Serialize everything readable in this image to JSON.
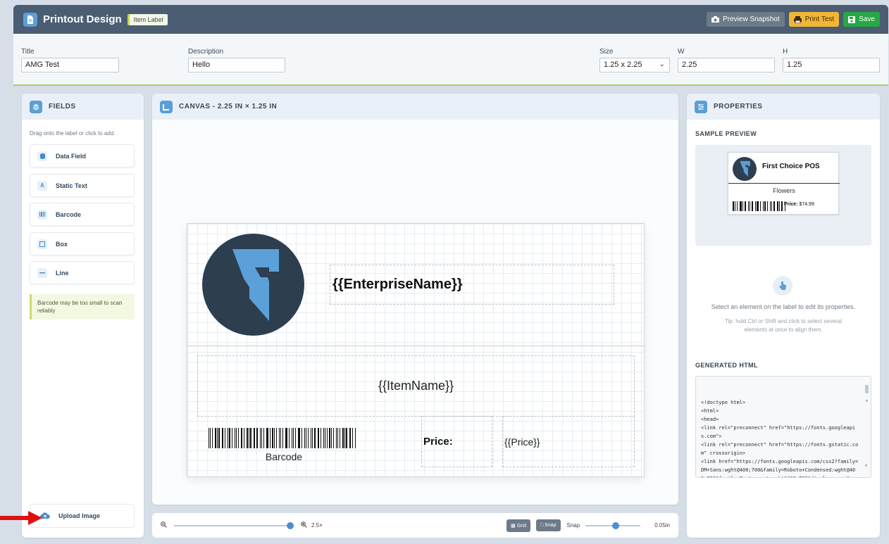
{
  "header": {
    "title": "Printout Design",
    "badge": "Item Label",
    "preview_snapshot": "Preview Snapshot",
    "print_test": "Print Test",
    "save": "Save"
  },
  "meta": {
    "title_label": "Title",
    "title_value": "AMG Test",
    "description_label": "Description",
    "description_value": "Hello",
    "size_label": "Size",
    "size_value": "1.25 x 2.25",
    "w_label": "W",
    "w_value": "2.25",
    "h_label": "H",
    "h_value": "1.25"
  },
  "fields_panel": {
    "title": "FIELDS",
    "hint": "Drag onto the label or click to add.",
    "items": [
      {
        "label": "Data Field",
        "icon": "database-icon"
      },
      {
        "label": "Static Text",
        "icon": "text-icon"
      },
      {
        "label": "Barcode",
        "icon": "barcode-icon"
      },
      {
        "label": "Box",
        "icon": "box-icon"
      },
      {
        "label": "Line",
        "icon": "line-icon"
      }
    ],
    "warning": "Barcode may be too small to scan reliably",
    "upload": "Upload Image"
  },
  "canvas": {
    "title": "CANVAS - 2.25 IN × 1.25 IN",
    "enterprise": "{{EnterpriseName}}",
    "item_name": "{{ItemName}}",
    "barcode_text": "Barcode",
    "price_label": "Price:",
    "price_value": "{{Price}}"
  },
  "zoombar": {
    "zoom": "2.5×",
    "grid": "Grid",
    "snap_btn": "Snap",
    "snap_label": "Snap",
    "snap_value": "0.05in",
    "zoom_level": 0.98,
    "snap_level": 0.55
  },
  "properties": {
    "title": "PROPERTIES",
    "sample_title": "SAMPLE PREVIEW",
    "sample_name": "First Choice POS",
    "sample_item": "Flowers",
    "sample_price_label": "Price:",
    "sample_price": "$74.99",
    "select_text": "Select an element on the label to edit its properties.",
    "tip": "Tip: hold Ctrl or Shift and click to select several elements at once to align them.",
    "html_title": "GENERATED HTML",
    "code": "<!doctype html>\n<html>\n<head>\n<link rel=\"preconnect\" href=\"https://fonts.googleapis.com\">\n<link rel=\"preconnect\" href=\"https://fonts.gstatic.com\" crossorigin>\n<link href=\"https://fonts.googleapis.com/css2?family=DM+Sans:wght@400;700&family=Roboto+Condensed:wght@400;700&family=Montserrat:wght@400;700&display=swap\" rel=\"stylesheet\">\n<style>"
  },
  "colors": {
    "header_bg": "#4a5d72",
    "accent": "#5a9fd6",
    "print_test": "#f2b636",
    "save": "#27a844"
  }
}
